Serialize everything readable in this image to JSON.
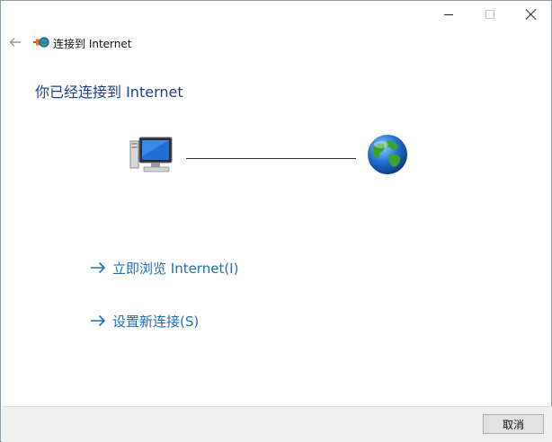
{
  "window": {
    "caption_buttons": [
      "minimize",
      "maximize",
      "close"
    ]
  },
  "header": {
    "title": "连接到 Internet",
    "back_icon": "arrow-left-icon",
    "wizard_icon": "network-connect-icon"
  },
  "main": {
    "heading": "你已经连接到 Internet",
    "graphic": {
      "left_icon": "computer-icon",
      "right_icon": "globe-icon"
    },
    "links": [
      {
        "label": "立即浏览 Internet(I)",
        "icon": "arrow-right-icon"
      },
      {
        "label": "设置新连接(S)",
        "icon": "arrow-right-icon"
      }
    ]
  },
  "footer": {
    "cancel_label": "取消"
  },
  "colors": {
    "heading": "#1b3f8f",
    "link": "#1c6eb8",
    "footer_bg": "#f0f0f0"
  }
}
